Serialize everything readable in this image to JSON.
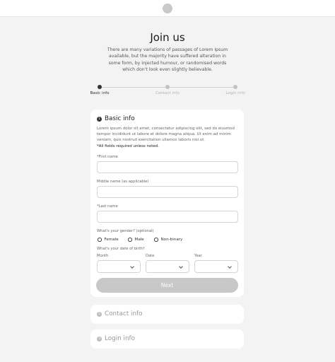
{
  "header": {
    "logo": "logo-circle"
  },
  "page": {
    "title": "Join us",
    "subtitle": "There are many variations of passages of Lorem Ipsum available, but the majority have suffered alteration in some form, by injected humour, or randomised words which don't look even slightly believable."
  },
  "steps": [
    {
      "label": "Basic info",
      "state": "active"
    },
    {
      "label": "Contact info",
      "state": "inactive"
    },
    {
      "label": "Login info",
      "state": "inactive"
    }
  ],
  "basic_info": {
    "number": "1",
    "title": "Basic info",
    "description": "Lorem ipsum dolor sit amet, consectetur adipiscing elit, sed do eiusmod tempor incididunt ut labore et dolore magna aliqua. Ut enim ad minim veniam, quis nostrud exercitation ullamco laboris nisi ut.",
    "required_note": "*All fields required unless noted.",
    "first_name": {
      "label": "*First name",
      "value": ""
    },
    "middle_name": {
      "label": "Middle name (as applicable)",
      "value": ""
    },
    "last_name": {
      "label": "*Last name",
      "value": ""
    },
    "gender": {
      "label": "What's your gender? (optional)",
      "options": [
        "Female",
        "Male",
        "Non-binary"
      ]
    },
    "dob": {
      "label": "What's your date of birth?",
      "month_label": "Month",
      "date_label": "Date",
      "year_label": "Year",
      "month_value": "",
      "date_value": "",
      "year_value": ""
    },
    "next_label": "Next"
  },
  "contact_info": {
    "number": "2",
    "title": "Contact info"
  },
  "login_info": {
    "number": "3",
    "title": "Login info"
  },
  "colors": {
    "background": "#f3f3f3",
    "card": "#ffffff",
    "active": "#333333",
    "inactive": "#c2c2c2",
    "button_disabled": "#c8c8c8"
  }
}
